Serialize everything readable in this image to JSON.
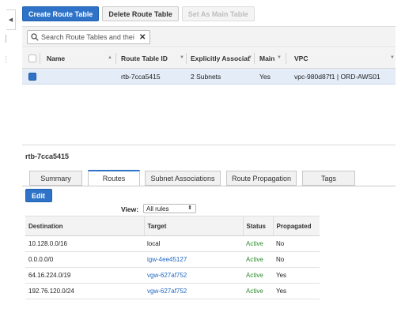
{
  "toolbar": {
    "create_label": "Create Route Table",
    "delete_label": "Delete Route Table",
    "set_main_label": "Set As Main Table"
  },
  "search": {
    "value": "Search Route Tables and thei"
  },
  "table": {
    "columns": {
      "name": "Name",
      "route_table_id": "Route Table ID",
      "explicitly_associated": "Explicitly Associat",
      "main": "Main",
      "vpc": "VPC"
    },
    "rows": [
      {
        "name": "",
        "route_table_id": "rtb-7cca5415",
        "explicitly_associated": "2 Subnets",
        "main": "Yes",
        "vpc": "vpc-980d87f1 | ORD-AWS01"
      }
    ]
  },
  "detail": {
    "title": "rtb-7cca5415",
    "tabs": [
      "Summary",
      "Routes",
      "Subnet Associations",
      "Route Propagation",
      "Tags"
    ],
    "active_tab": "Routes",
    "edit_label": "Edit",
    "view_label": "View:",
    "view_value": "All rules",
    "routes_columns": {
      "destination": "Destination",
      "target": "Target",
      "status": "Status",
      "propagated": "Propagated"
    },
    "routes": [
      {
        "destination": "10.128.0.0/16",
        "target": "local",
        "status": "Active",
        "propagated": "No"
      },
      {
        "destination": "0.0.0.0/0",
        "target": "igw-4ee45127",
        "status": "Active",
        "propagated": "No"
      },
      {
        "destination": "64.16.224.0/19",
        "target": "vgw-627af752",
        "status": "Active",
        "propagated": "Yes"
      },
      {
        "destination": "192.76.120.0/24",
        "target": "vgw-627af752",
        "status": "Active",
        "propagated": "Yes"
      }
    ]
  },
  "colors": {
    "primary": "#2e73c8",
    "selected_row": "#e3ecf7",
    "link": "#1f66c1",
    "active_status": "#2e8b2e"
  }
}
